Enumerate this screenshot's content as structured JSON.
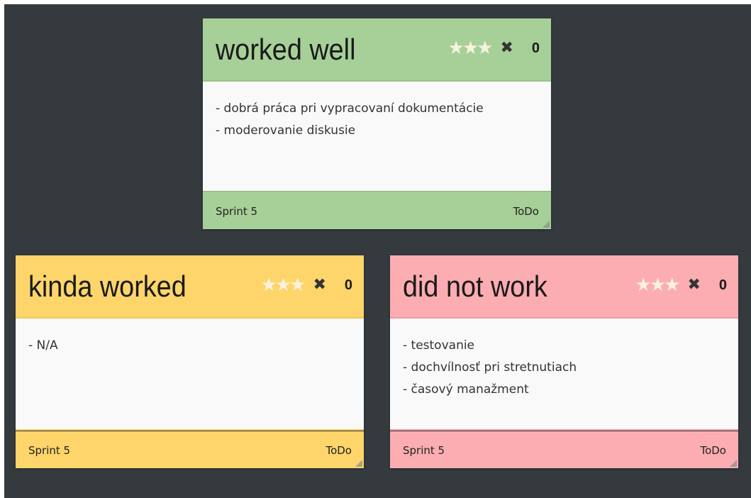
{
  "cards": [
    {
      "title": "worked well",
      "votes": "0",
      "star_icon": "★",
      "delete_icon": "✖",
      "lines": [
        "- dobrá práca pri vypracovaní dokumentácie",
        "- moderovanie diskusie"
      ],
      "sprint": "Sprint 5",
      "status": "ToDo",
      "color": "#a7d098"
    },
    {
      "title": "kinda worked",
      "votes": "0",
      "star_icon": "★",
      "delete_icon": "✖",
      "lines": [
        "- N/A"
      ],
      "sprint": "Sprint 5",
      "status": "ToDo",
      "color": "#fdd56b"
    },
    {
      "title": "did not work",
      "votes": "0",
      "star_icon": "★",
      "delete_icon": "✖",
      "lines": [
        "- testovanie",
        "- dochvílnosť pri stretnutiach",
        "- časový manažment"
      ],
      "sprint": "Sprint 5",
      "status": "ToDo",
      "color": "#fbadb2"
    }
  ],
  "colors": {
    "board_background": "#343a3e",
    "card_body": "#f9f9f9",
    "star": "#f8f1dc"
  }
}
